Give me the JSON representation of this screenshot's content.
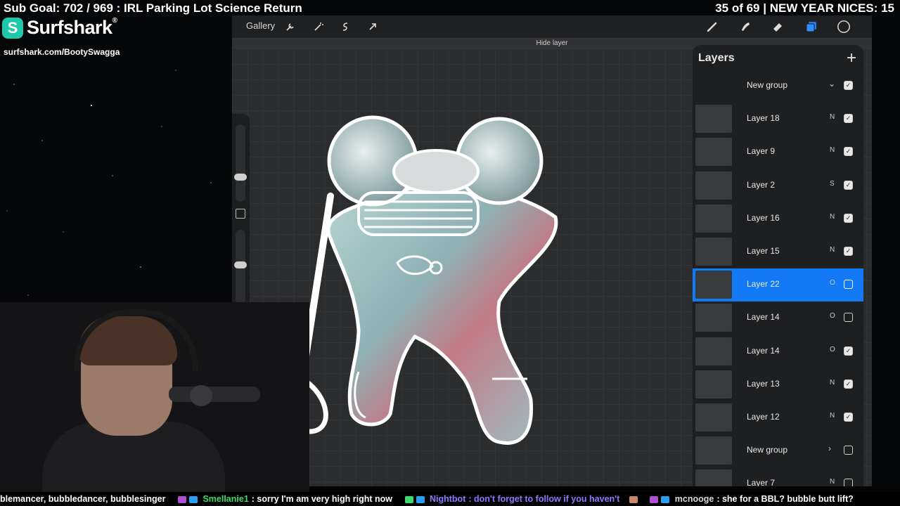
{
  "overlay": {
    "sub_goal": "Sub Goal: 702 / 969 : IRL Parking Lot Science Return",
    "counter": "35 of 69 | NEW YEAR NICES: 15",
    "sponsor_name": "Surfshark",
    "sponsor_reg": "®",
    "sponsor_url": "surfshark.com/BootySwagga"
  },
  "toolbar": {
    "gallery": "Gallery",
    "hide_layer": "Hide layer"
  },
  "layers": {
    "title": "Layers",
    "add": "+",
    "items": [
      {
        "name": "New group",
        "mode": "",
        "checked": true,
        "group": true,
        "chevron": "⌄"
      },
      {
        "name": "Layer 18",
        "mode": "N",
        "checked": true
      },
      {
        "name": "Layer 9",
        "mode": "N",
        "checked": true
      },
      {
        "name": "Layer 2",
        "mode": "S",
        "checked": true
      },
      {
        "name": "Layer 16",
        "mode": "N",
        "checked": true
      },
      {
        "name": "Layer 15",
        "mode": "N",
        "checked": true
      },
      {
        "name": "Layer 22",
        "mode": "O",
        "checked": false,
        "selected": true
      },
      {
        "name": "Layer 14",
        "mode": "O",
        "checked": false
      },
      {
        "name": "Layer 14",
        "mode": "O",
        "checked": true
      },
      {
        "name": "Layer 13",
        "mode": "N",
        "checked": true
      },
      {
        "name": "Layer 12",
        "mode": "N",
        "checked": true
      },
      {
        "name": "New group",
        "mode": "",
        "checked": false,
        "group": true,
        "chevron": "›"
      },
      {
        "name": "Layer 7",
        "mode": "N",
        "checked": false
      }
    ]
  },
  "chat": {
    "msg0_text": "blemancer, bubbledancer, bubblesinger",
    "msg1_user": "Smellanie1",
    "msg1_text": ": sorry I'm am very high right now",
    "msg2_user": "Nightbot",
    "msg2_text": ": don't forget to follow if you haven't",
    "msg3_user": "mcnooge",
    "msg3_text": ": she for a BBL? bubble butt lift?",
    "colors": {
      "smellanie": "#3ddc6a",
      "nightbot": "#8a7cff",
      "mcnooge": "#d9d9d9"
    }
  },
  "colors": {
    "selected_row": "#1479f5",
    "panel_bg": "#1e1f21",
    "canvas_bg": "#2b2c2e",
    "sponsor_accent": "#1ec9a9"
  }
}
